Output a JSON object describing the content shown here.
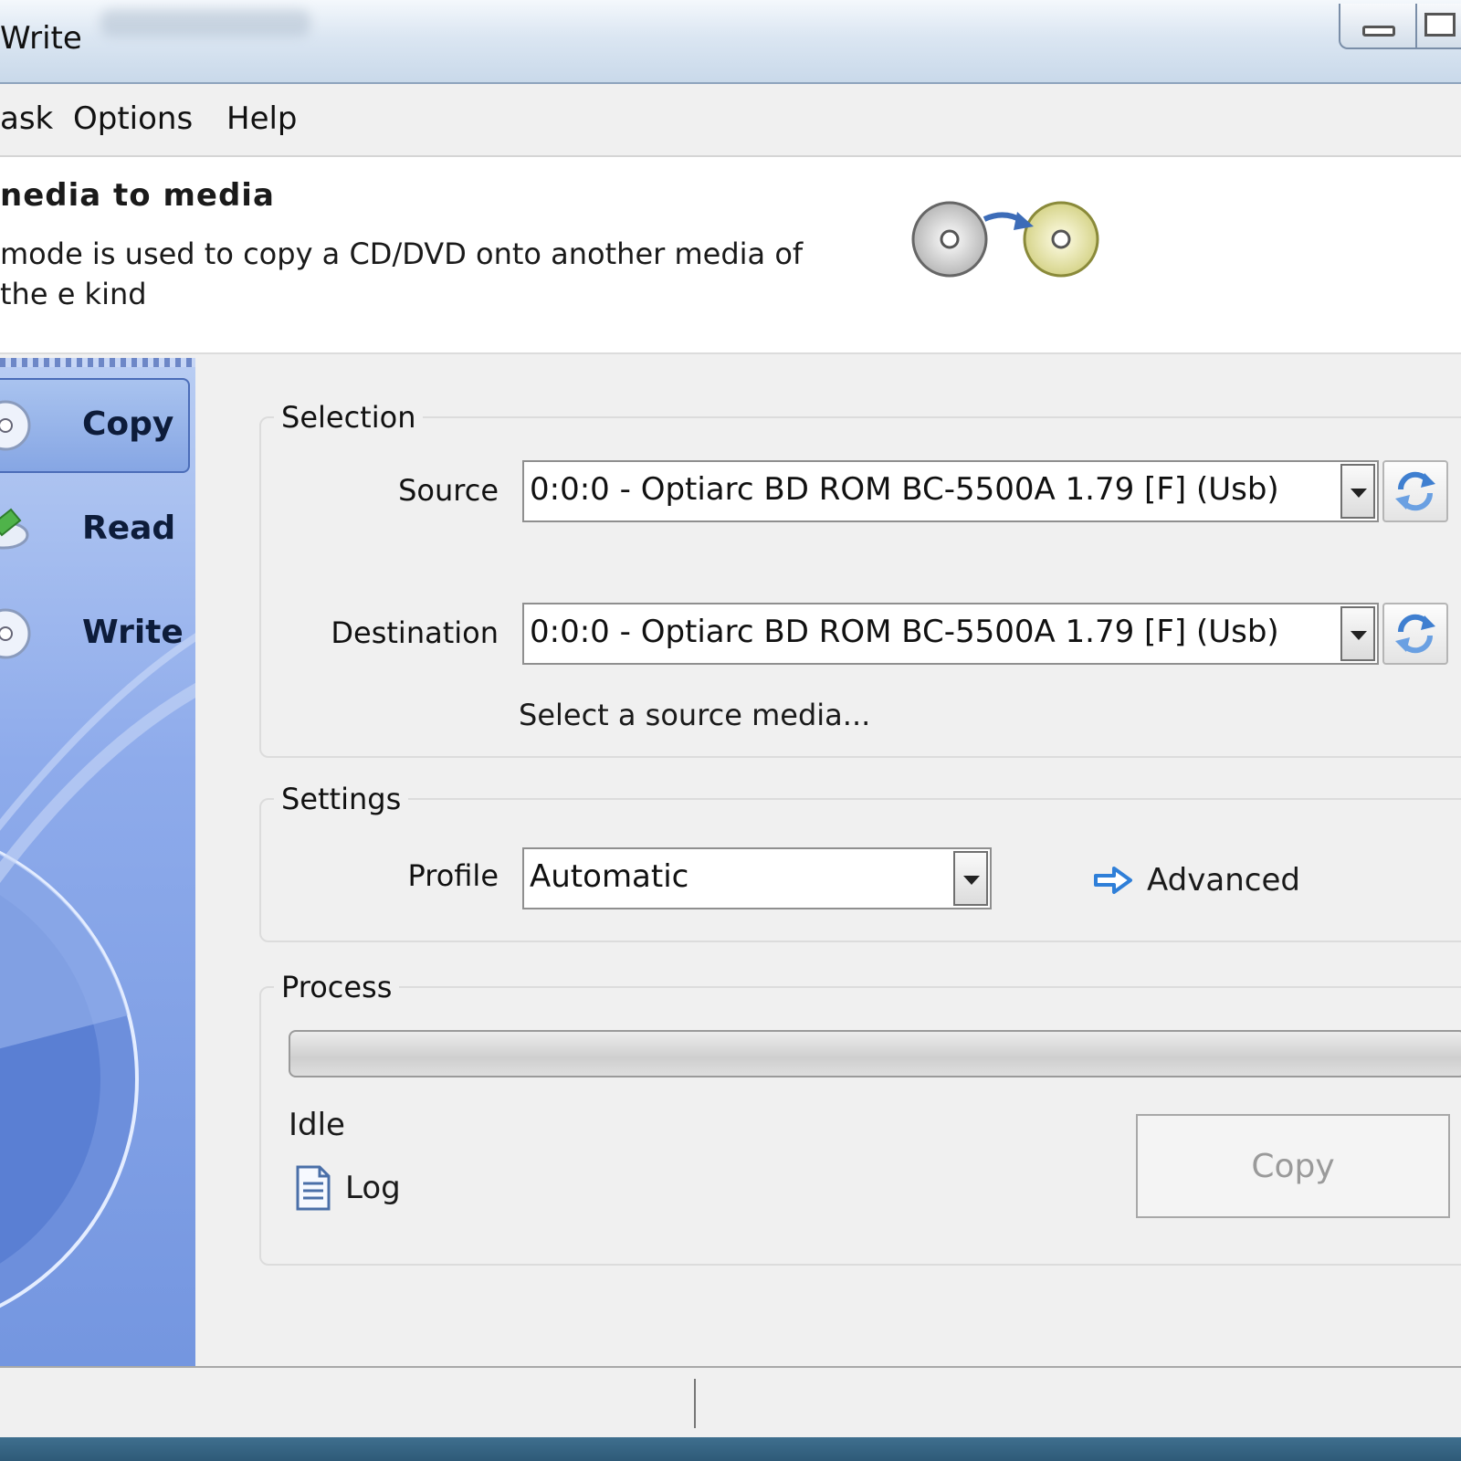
{
  "window": {
    "title": "Write"
  },
  "menu": {
    "items": [
      "ask",
      "Options",
      "Help"
    ]
  },
  "header": {
    "title": "nedia to media",
    "description": "mode is used to copy a CD/DVD onto another media of the e kind"
  },
  "sidebar": {
    "items": [
      {
        "label": "Copy",
        "active": true,
        "icon": "disc-copy-icon"
      },
      {
        "label": "Read",
        "active": false,
        "icon": "disc-read-icon"
      },
      {
        "label": "Write",
        "active": false,
        "icon": "disc-write-icon"
      }
    ]
  },
  "selection": {
    "legend": "Selection",
    "source_label": "Source",
    "source_value": "0:0:0 - Optiarc BD ROM BC-5500A 1.79 [F] (Usb)",
    "destination_label": "Destination",
    "destination_value": "0:0:0 - Optiarc BD ROM BC-5500A 1.79 [F] (Usb)",
    "hint": "Select a source media..."
  },
  "settings": {
    "legend": "Settings",
    "profile_label": "Profile",
    "profile_value": "Automatic",
    "advanced_label": "Advanced"
  },
  "process": {
    "legend": "Process",
    "progress": 0,
    "status": "Idle",
    "log_label": "Log",
    "copy_button": "Copy"
  },
  "colors": {
    "sidebar_accent": "#7496e0",
    "refresh_icon": "#3f7fd0",
    "advanced_arrow": "#2f7fd8"
  }
}
